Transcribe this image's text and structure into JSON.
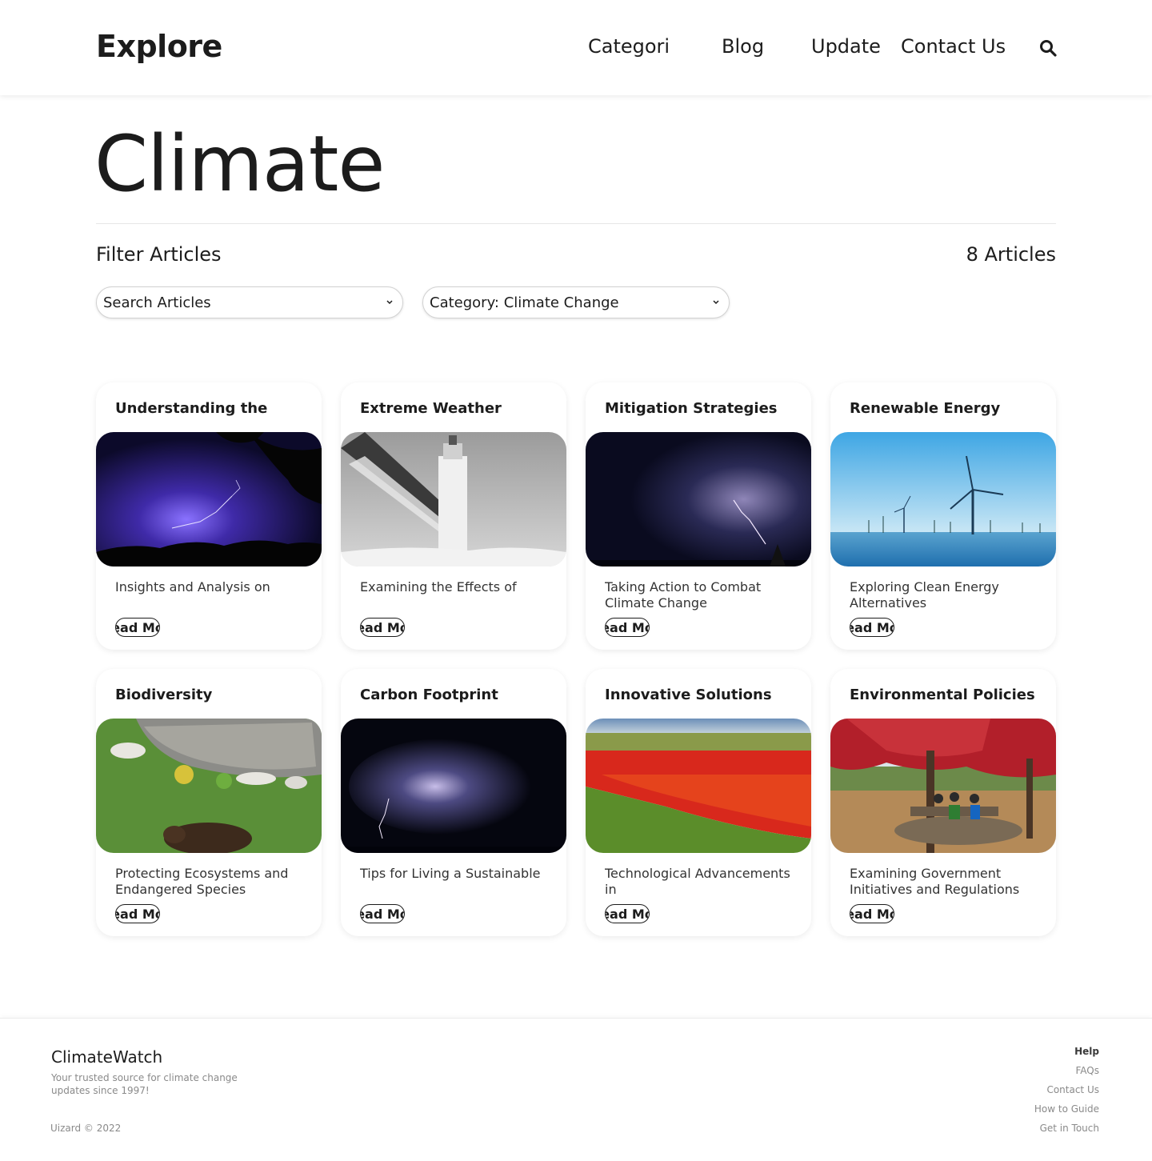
{
  "header": {
    "logo": "Explore",
    "nav": [
      "Categori",
      "Blog",
      "Update",
      "Contact Us"
    ]
  },
  "page": {
    "title": "Climate",
    "filter_title": "Filter Articles",
    "count": "8 Articles"
  },
  "filters": {
    "search_label": "Search Articles",
    "category_label": "Category: Climate Change"
  },
  "cards": [
    {
      "title": "Understanding the",
      "desc": "Insights and Analysis on",
      "button": "ead Mo",
      "image": "purple-lightning-storm"
    },
    {
      "title": "Extreme Weather",
      "desc": "Examining the Effects of",
      "button": "ead Mo",
      "image": "frozen-lighthouse"
    },
    {
      "title": "Mitigation Strategies",
      "desc": "Taking Action to Combat Climate Change",
      "button": "ead Mo",
      "image": "night-storm-clouds"
    },
    {
      "title": "Renewable Energy",
      "desc": "Exploring Clean Energy Alternatives",
      "button": "ead Mo",
      "image": "offshore-wind-turbines"
    },
    {
      "title": "Biodiversity",
      "desc": "Protecting Ecosystems and Endangered Species",
      "button": "ead Mo",
      "image": "bear-in-garden"
    },
    {
      "title": "Carbon Footprint",
      "desc": "Tips for Living a Sustainable",
      "button": "ead Mo",
      "image": "thunderstorm-cell"
    },
    {
      "title": "Innovative Solutions",
      "desc": "Technological Advancements in",
      "button": "ead Mo",
      "image": "red-flower-field"
    },
    {
      "title": "Environmental Policies",
      "desc": "Examining Government Initiatives and Regulations",
      "button": "ead Mo",
      "image": "red-tree-picnic"
    }
  ],
  "footer": {
    "brand": "ClimateWatch",
    "tagline": "Your trusted source for climate change updates since 1997!",
    "copyright": "Uizard © 2022",
    "links_heading": "Help",
    "links": [
      "FAQs",
      "Contact Us",
      "How to Guide",
      "Get in Touch"
    ]
  }
}
